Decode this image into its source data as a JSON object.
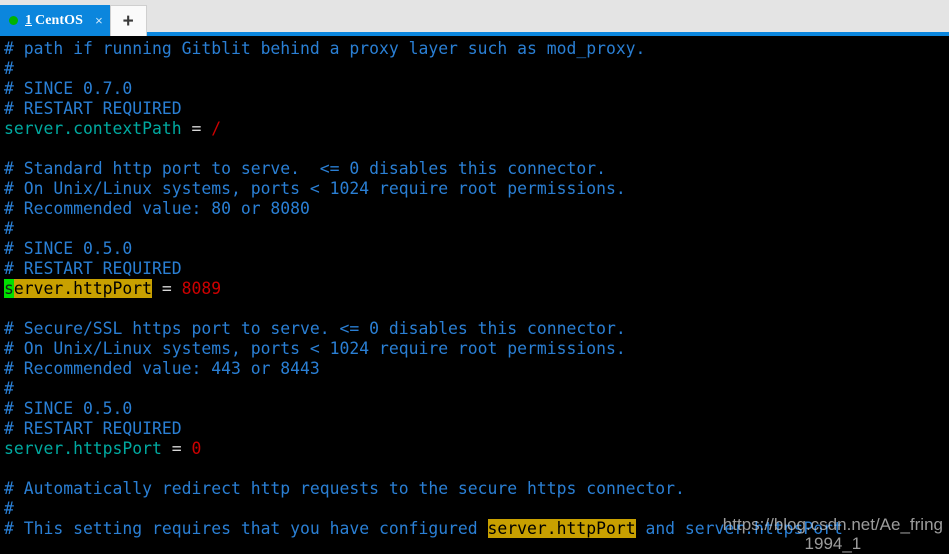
{
  "window": {
    "title": "1 CentOS"
  },
  "tabbar": {
    "tab_index": "1",
    "tab_title": "CentOS",
    "close_label": "×",
    "new_tab_label": "+",
    "status_dot_color": "#00b300",
    "active_tab_color": "#0b86dd",
    "bar_color": "#e4e4e4"
  },
  "colors": {
    "background": "#000000",
    "comment": "#2a7fd4",
    "key": "#00a9a0",
    "equals": "#d8d8d8",
    "value": "#cc0000",
    "search_highlight_bg": "#c8a000",
    "search_highlight_fg": "#000000",
    "cursor_bg": "#00e000"
  },
  "terminal": {
    "lines": [
      {
        "type": "comment",
        "text": "# path if running Gitblit behind a proxy layer such as mod_proxy."
      },
      {
        "type": "comment",
        "text": "#"
      },
      {
        "type": "comment",
        "text": "# SINCE 0.7.0"
      },
      {
        "type": "comment",
        "text": "# RESTART REQUIRED"
      },
      {
        "type": "setting",
        "key": "server.contextPath",
        "eq": " = ",
        "value": "/"
      },
      {
        "type": "blank",
        "text": ""
      },
      {
        "type": "comment",
        "text": "# Standard http port to serve.  <= 0 disables this connector."
      },
      {
        "type": "comment",
        "text": "# On Unix/Linux systems, ports < 1024 require root permissions."
      },
      {
        "type": "comment",
        "text": "# Recommended value: 80 or 8080"
      },
      {
        "type": "comment",
        "text": "#"
      },
      {
        "type": "comment",
        "text": "# SINCE 0.5.0"
      },
      {
        "type": "comment",
        "text": "# RESTART REQUIRED"
      },
      {
        "type": "setting-highlight",
        "cursor_char": "s",
        "key_rest": "erver.httpPort",
        "eq": " = ",
        "value": "8089"
      },
      {
        "type": "blank",
        "text": ""
      },
      {
        "type": "comment",
        "text": "# Secure/SSL https port to serve. <= 0 disables this connector."
      },
      {
        "type": "comment",
        "text": "# On Unix/Linux systems, ports < 1024 require root permissions."
      },
      {
        "type": "comment",
        "text": "# Recommended value: 443 or 8443"
      },
      {
        "type": "comment",
        "text": "#"
      },
      {
        "type": "comment",
        "text": "# SINCE 0.5.0"
      },
      {
        "type": "comment",
        "text": "# RESTART REQUIRED"
      },
      {
        "type": "setting",
        "key": "server.httpsPort",
        "eq": " = ",
        "value": "0"
      },
      {
        "type": "blank",
        "text": ""
      },
      {
        "type": "comment",
        "text": "# Automatically redirect http requests to the secure https connector."
      },
      {
        "type": "comment",
        "text": "#"
      },
      {
        "type": "comment-highlight",
        "prefix": "# This setting requires that you have configured ",
        "highlight": "server.httpPort",
        "suffix": " and server.httpsPort"
      }
    ]
  },
  "watermark": {
    "url": "https://blog.csdn.net/Ae_fring",
    "subtitle": "1994_1"
  }
}
